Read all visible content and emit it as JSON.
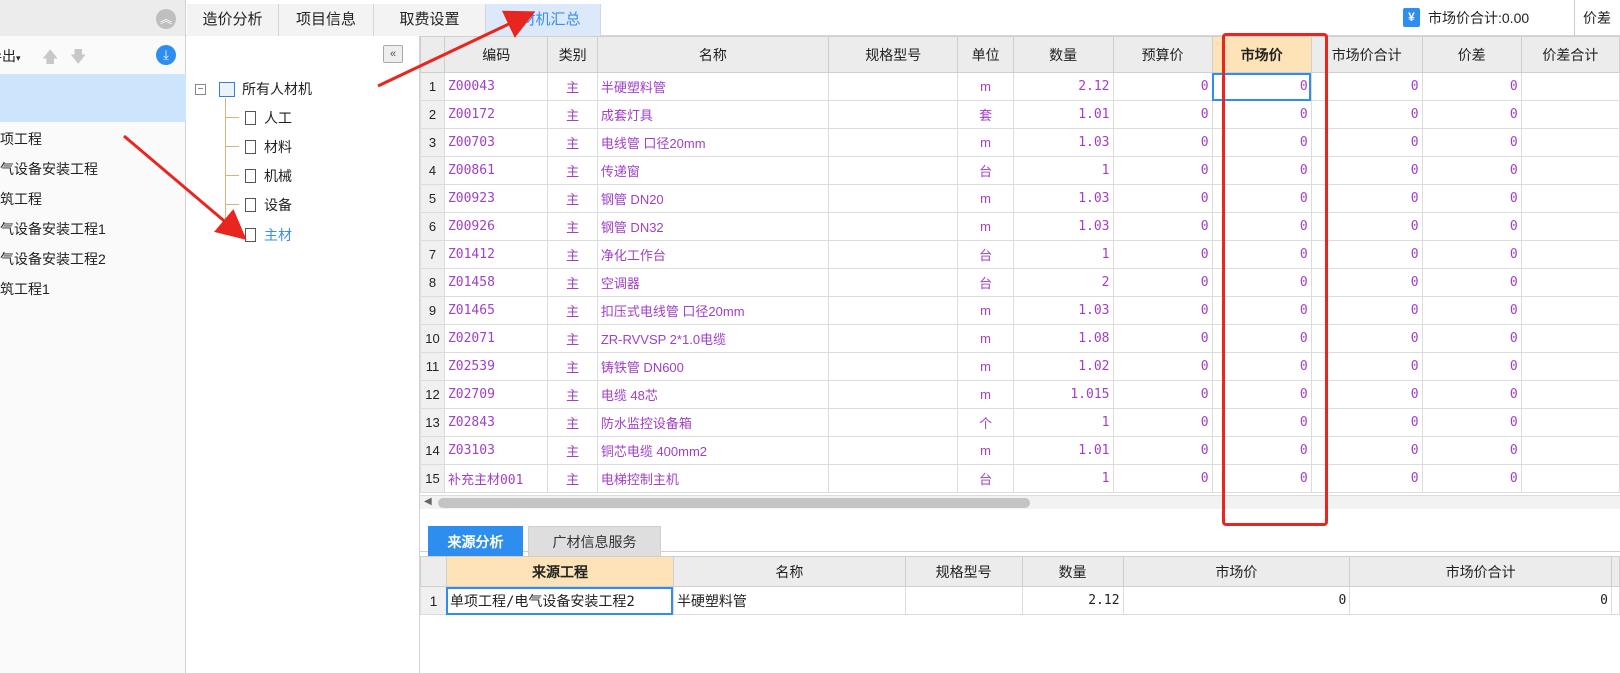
{
  "top_tabs": [
    {
      "label": "造价分析",
      "active": false
    },
    {
      "label": "项目信息",
      "active": false
    },
    {
      "label": "取费设置",
      "active": false
    },
    {
      "label": "人材机汇总",
      "active": true
    }
  ],
  "summary": {
    "market_total": "市场价合计:0.00",
    "diff_total": "价差合"
  },
  "left_pane": {
    "export_label": "导出",
    "projects": [
      "项工程",
      "气设备安装工程",
      "筑工程",
      "气设备安装工程1",
      "气设备安装工程2",
      "筑工程1"
    ]
  },
  "tree": {
    "root": "所有人材机",
    "children": [
      "人工",
      "材料",
      "机械",
      "设备",
      "主材"
    ],
    "selected": "主材"
  },
  "grid": {
    "headers": [
      "编码",
      "类别",
      "名称",
      "规格型号",
      "单位",
      "数量",
      "预算价",
      "市场价",
      "市场价合计",
      "价差",
      "价差合计"
    ],
    "rows": [
      {
        "no": "1",
        "code": "Z00043",
        "kind": "主",
        "name": "半硬塑料管",
        "spec": "",
        "unit": "m",
        "qty": "2.12",
        "budget": "0",
        "market": "0",
        "market_total": "0",
        "diff": "0"
      },
      {
        "no": "2",
        "code": "Z00172",
        "kind": "主",
        "name": "成套灯具",
        "spec": "",
        "unit": "套",
        "qty": "1.01",
        "budget": "0",
        "market": "0",
        "market_total": "0",
        "diff": "0"
      },
      {
        "no": "3",
        "code": "Z00703",
        "kind": "主",
        "name": "电线管 口径20mm",
        "spec": "",
        "unit": "m",
        "qty": "1.03",
        "budget": "0",
        "market": "0",
        "market_total": "0",
        "diff": "0"
      },
      {
        "no": "4",
        "code": "Z00861",
        "kind": "主",
        "name": "传递窗",
        "spec": "",
        "unit": "台",
        "qty": "1",
        "budget": "0",
        "market": "0",
        "market_total": "0",
        "diff": "0"
      },
      {
        "no": "5",
        "code": "Z00923",
        "kind": "主",
        "name": "钢管 DN20",
        "spec": "",
        "unit": "m",
        "qty": "1.03",
        "budget": "0",
        "market": "0",
        "market_total": "0",
        "diff": "0"
      },
      {
        "no": "6",
        "code": "Z00926",
        "kind": "主",
        "name": "钢管 DN32",
        "spec": "",
        "unit": "m",
        "qty": "1.03",
        "budget": "0",
        "market": "0",
        "market_total": "0",
        "diff": "0"
      },
      {
        "no": "7",
        "code": "Z01412",
        "kind": "主",
        "name": "净化工作台",
        "spec": "",
        "unit": "台",
        "qty": "1",
        "budget": "0",
        "market": "0",
        "market_total": "0",
        "diff": "0"
      },
      {
        "no": "8",
        "code": "Z01458",
        "kind": "主",
        "name": "空调器",
        "spec": "",
        "unit": "台",
        "qty": "2",
        "budget": "0",
        "market": "0",
        "market_total": "0",
        "diff": "0"
      },
      {
        "no": "9",
        "code": "Z01465",
        "kind": "主",
        "name": "扣压式电线管 口径20mm",
        "spec": "",
        "unit": "m",
        "qty": "1.03",
        "budget": "0",
        "market": "0",
        "market_total": "0",
        "diff": "0"
      },
      {
        "no": "10",
        "code": "Z02071",
        "kind": "主",
        "name": "ZR-RVVSP 2*1.0电缆",
        "spec": "",
        "unit": "m",
        "qty": "1.08",
        "budget": "0",
        "market": "0",
        "market_total": "0",
        "diff": "0"
      },
      {
        "no": "11",
        "code": "Z02539",
        "kind": "主",
        "name": "铸铁管 DN600",
        "spec": "",
        "unit": "m",
        "qty": "1.02",
        "budget": "0",
        "market": "0",
        "market_total": "0",
        "diff": "0"
      },
      {
        "no": "12",
        "code": "Z02709",
        "kind": "主",
        "name": "电缆 48芯",
        "spec": "",
        "unit": "m",
        "qty": "1.015",
        "budget": "0",
        "market": "0",
        "market_total": "0",
        "diff": "0"
      },
      {
        "no": "13",
        "code": "Z02843",
        "kind": "主",
        "name": "防水监控设备箱",
        "spec": "",
        "unit": "个",
        "qty": "1",
        "budget": "0",
        "market": "0",
        "market_total": "0",
        "diff": "0"
      },
      {
        "no": "14",
        "code": "Z03103",
        "kind": "主",
        "name": "铜芯电缆 400mm2",
        "spec": "",
        "unit": "m",
        "qty": "1.01",
        "budget": "0",
        "market": "0",
        "market_total": "0",
        "diff": "0"
      },
      {
        "no": "15",
        "code": "补充主材001",
        "kind": "主",
        "name": "电梯控制主机",
        "spec": "",
        "unit": "台",
        "qty": "1",
        "budget": "0",
        "market": "0",
        "market_total": "0",
        "diff": "0"
      }
    ]
  },
  "bottom_tabs": [
    {
      "label": "来源分析",
      "active": true
    },
    {
      "label": "广材信息服务",
      "active": false
    }
  ],
  "bottom_grid": {
    "headers": [
      "来源工程",
      "名称",
      "规格型号",
      "数量",
      "市场价",
      "市场价合计"
    ],
    "rows": [
      {
        "no": "1",
        "source": "单项工程/电气设备安装工程2",
        "name": "半硬塑料管",
        "spec": "",
        "qty": "2.12",
        "market": "0",
        "market_total": "0"
      }
    ]
  },
  "colors": {
    "accent": "#2e8ef0",
    "highlight_red": "#e8261f",
    "row_text": "#a03fc7",
    "header_highlight": "#fde3b7"
  }
}
